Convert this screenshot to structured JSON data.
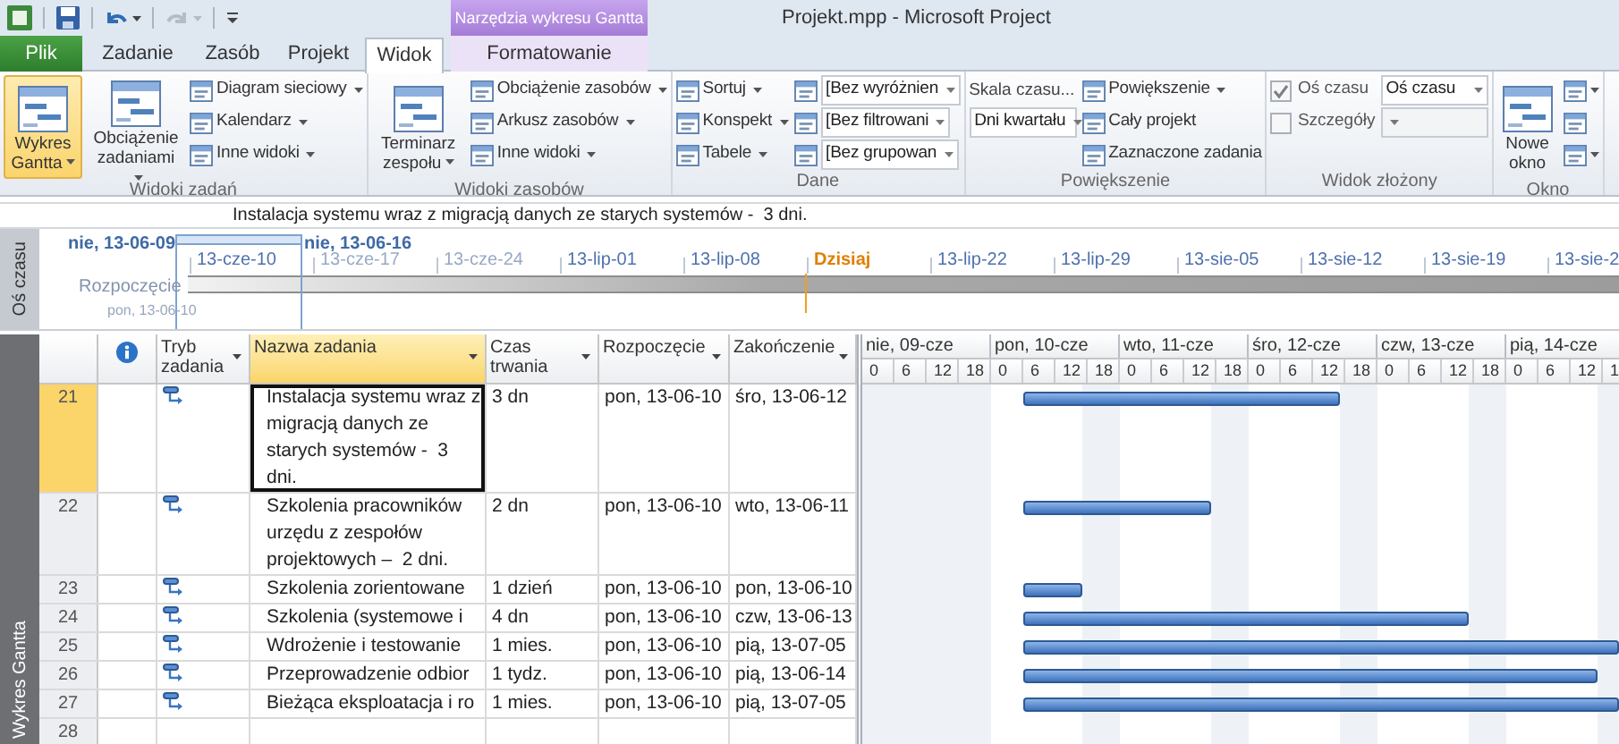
{
  "quick_access": [
    {
      "kind": "app",
      "disabled": false
    },
    {
      "kind": "save",
      "disabled": false
    },
    {
      "kind": "undo",
      "disabled": false
    },
    {
      "kind": "redo",
      "disabled": true
    },
    {
      "kind": "customize",
      "disabled": false
    }
  ],
  "context_tab_group": {
    "label": "Narzędzia wykresu Gantta"
  },
  "window": {
    "title": "Projekt.mpp - Microsoft Project"
  },
  "tabs": [
    {
      "label": "Plik",
      "kind": "file",
      "selected": false
    },
    {
      "label": "Zadanie",
      "kind": "normal",
      "selected": false
    },
    {
      "label": "Zasób",
      "kind": "normal",
      "selected": false
    },
    {
      "label": "Projekt",
      "kind": "normal",
      "selected": false
    },
    {
      "label": "Widok",
      "kind": "normal",
      "selected": true
    },
    {
      "label": "Formatowanie",
      "kind": "context",
      "selected": false
    }
  ],
  "ribbon": {
    "groups": [
      {
        "label": "Widoki zadań",
        "columns": [
          [
            {
              "kind": "large",
              "label": "Wykres Gantta",
              "selected": true,
              "dropdown": true
            }
          ],
          [
            {
              "kind": "large",
              "label": "Obciążenie zadaniami",
              "selected": false,
              "dropdown": true
            }
          ],
          [
            {
              "kind": "small",
              "label": "Diagram sieciowy",
              "dropdown": true
            },
            {
              "kind": "small",
              "label": "Kalendarz",
              "dropdown": true
            },
            {
              "kind": "small",
              "label": "Inne widoki",
              "dropdown": true
            }
          ]
        ]
      },
      {
        "label": "Widoki zasobów",
        "columns": [
          [
            {
              "kind": "large",
              "label": "Terminarz zespołu",
              "selected": false,
              "dropdown": true
            }
          ],
          [
            {
              "kind": "small",
              "label": "Obciążenie zasobów",
              "dropdown": true
            },
            {
              "kind": "small",
              "label": "Arkusz zasobów",
              "dropdown": true
            },
            {
              "kind": "small",
              "label": "Inne widoki",
              "dropdown": true
            }
          ]
        ]
      },
      {
        "label": "Dane",
        "columns": [
          [
            {
              "kind": "small",
              "label": "Sortuj",
              "dropdown": true
            },
            {
              "kind": "small",
              "label": "Konspekt",
              "dropdown": true
            },
            {
              "kind": "small",
              "label": "Tabele",
              "dropdown": true
            }
          ],
          [
            {
              "kind": "icon_select",
              "value": "[Bez wyróżnien"
            },
            {
              "kind": "icon_select",
              "value": "[Bez filtrowani"
            },
            {
              "kind": "icon_select",
              "value": "[Bez grupowan"
            }
          ]
        ]
      },
      {
        "label": "Powiększenie",
        "columns": [
          [
            {
              "kind": "text",
              "label": "Skala czasu..."
            },
            {
              "kind": "select",
              "value": "Dni kwartału"
            }
          ],
          [
            {
              "kind": "small",
              "label": "Powiększenie",
              "dropdown": true
            },
            {
              "kind": "small",
              "label": "Cały projekt",
              "dropdown": false
            },
            {
              "kind": "small",
              "label": "Zaznaczone zadania",
              "dropdown": false
            }
          ]
        ]
      },
      {
        "label": "Widok złożony",
        "columns": [
          [
            {
              "kind": "checkbox",
              "label": "Oś czasu",
              "checked": true
            },
            {
              "kind": "checkbox",
              "label": "Szczegóły",
              "checked": false
            }
          ],
          [
            {
              "kind": "select",
              "value": "Oś czasu"
            },
            {
              "kind": "select"
            }
          ]
        ]
      },
      {
        "label": "Okno",
        "columns": [
          [
            {
              "kind": "large",
              "label": "Nowe okno",
              "selected": false,
              "dropdown": false
            }
          ],
          [
            {
              "kind": "icon",
              "dropdown": true
            },
            {
              "kind": "icon",
              "dropdown": false
            },
            {
              "kind": "icon",
              "dropdown": true
            }
          ]
        ]
      }
    ]
  },
  "entry_bar": {
    "text": "Instalacja systemu wraz z migracją danych ze starych systemów -  3 dni."
  },
  "timeline": {
    "label": "Oś czasu",
    "range_start": "nie, 13-06-09",
    "range_end": "nie, 13-06-16",
    "start_label": "Rozpoczęcie",
    "start_date": "pon, 13-06-10",
    "ticks": [
      {
        "label": "13-cze-10",
        "kind": "date",
        "dimmed": false
      },
      {
        "label": "13-cze-17",
        "kind": "date",
        "dimmed": true
      },
      {
        "label": "13-cze-24",
        "kind": "date",
        "dimmed": true
      },
      {
        "label": "13-lip-01",
        "kind": "date",
        "dimmed": false
      },
      {
        "label": "13-lip-08",
        "kind": "date",
        "dimmed": false
      },
      {
        "label": "Dzisiaj",
        "kind": "today"
      },
      {
        "label": "13-lip-22",
        "kind": "date",
        "dimmed": false
      },
      {
        "label": "13-lip-29",
        "kind": "date",
        "dimmed": false
      },
      {
        "label": "13-sie-05",
        "kind": "date",
        "dimmed": false
      },
      {
        "label": "13-sie-12",
        "kind": "date",
        "dimmed": false
      },
      {
        "label": "13-sie-19",
        "kind": "date",
        "dimmed": false
      },
      {
        "label": "13-sie-2",
        "kind": "date",
        "dimmed": false
      }
    ]
  },
  "view_bar": {
    "label": "Wykres Gantta"
  },
  "table": {
    "columns": [
      {
        "kind": "info",
        "selected": false
      },
      {
        "kind": "text",
        "label": "Tryb zadania",
        "selected": false
      },
      {
        "kind": "text",
        "label": "Nazwa zadania",
        "selected": true
      },
      {
        "kind": "text",
        "label": "Czas trwania",
        "selected": false
      },
      {
        "kind": "text",
        "label": "Rozpoczęcie",
        "selected": false
      },
      {
        "kind": "text",
        "label": "Zakończenie",
        "selected": false
      }
    ],
    "rows": [
      {
        "id": "21",
        "kind": "task",
        "selected": true,
        "name": "Instalacja systemu wraz z migracją danych ze starych systemów -  3 dni.",
        "duration": "3 dn",
        "start": "pon, 13-06-10",
        "finish": "śro, 13-06-12"
      },
      {
        "id": "22",
        "kind": "task",
        "selected": false,
        "name": "Szkolenia pracowników urzędu z zespołów projektowych –  2 dni.",
        "duration": "2 dn",
        "start": "pon, 13-06-10",
        "finish": "wto, 13-06-11"
      },
      {
        "id": "23",
        "kind": "task",
        "selected": false,
        "name": "Szkolenia zorientowane",
        "duration": "1 dzień",
        "start": "pon, 13-06-10",
        "finish": "pon, 13-06-10"
      },
      {
        "id": "24",
        "kind": "task",
        "selected": false,
        "name": "Szkolenia (systemowe i",
        "duration": "4 dn",
        "start": "pon, 13-06-10",
        "finish": "czw, 13-06-13"
      },
      {
        "id": "25",
        "kind": "task",
        "selected": false,
        "name": "Wdrożenie i testowanie",
        "duration": "1 mies.",
        "start": "pon, 13-06-10",
        "finish": "pią, 13-07-05"
      },
      {
        "id": "26",
        "kind": "task",
        "selected": false,
        "name": "Przeprowadzenie odbior",
        "duration": "1 tydz.",
        "start": "pon, 13-06-10",
        "finish": "pią, 13-06-14"
      },
      {
        "id": "27",
        "kind": "task",
        "selected": false,
        "name": "Bieżąca eksploatacja i ro",
        "duration": "1 mies.",
        "start": "pon, 13-06-10",
        "finish": "pią, 13-07-05"
      },
      {
        "id": "28",
        "kind": "blank",
        "selected": false
      }
    ]
  },
  "gantt": {
    "days": [
      {
        "label": "nie, 09-cze",
        "hours": [
          "0",
          "6",
          "12",
          "18"
        ]
      },
      {
        "label": "pon, 10-cze",
        "hours": [
          "0",
          "6",
          "12",
          "18"
        ]
      },
      {
        "label": "wto, 11-cze",
        "hours": [
          "0",
          "6",
          "12",
          "18"
        ]
      },
      {
        "label": "śro, 12-cze",
        "hours": [
          "0",
          "6",
          "12",
          "18"
        ]
      },
      {
        "label": "czw, 13-cze",
        "hours": [
          "0",
          "6",
          "12",
          "18"
        ]
      },
      {
        "label": "pią, 14-cze",
        "hours": [
          "0",
          "6",
          "12",
          "1"
        ]
      }
    ]
  }
}
